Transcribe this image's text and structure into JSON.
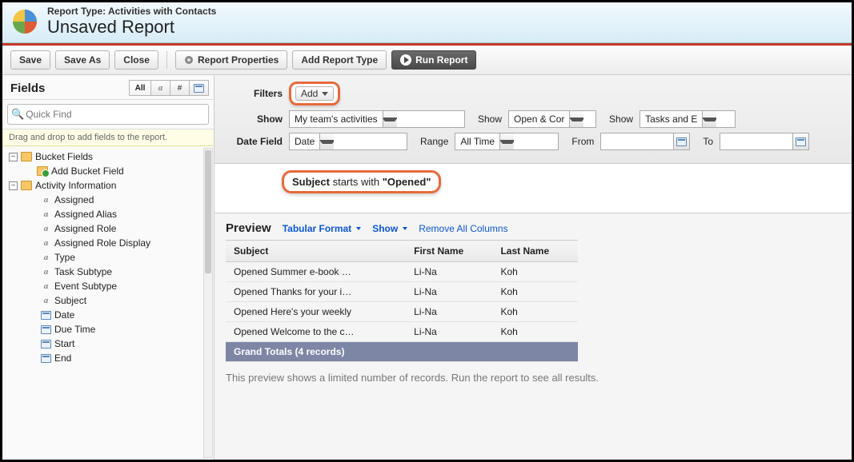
{
  "header": {
    "report_type_label": "Report Type: Activities with Contacts",
    "report_name": "Unsaved Report"
  },
  "toolbar": {
    "save": "Save",
    "save_as": "Save As",
    "close": "Close",
    "report_props": "Report Properties",
    "add_report_type": "Add Report Type",
    "run_report": "Run Report"
  },
  "sidebar": {
    "title": "Fields",
    "filter_all": "All",
    "quickfind_placeholder": "Quick Find",
    "drag_hint": "Drag and drop to add fields to the report.",
    "bucket_fields_label": "Bucket Fields",
    "add_bucket_label": "Add Bucket Field",
    "activity_info_label": "Activity Information",
    "fields": [
      {
        "label": "Assigned",
        "type": "text"
      },
      {
        "label": "Assigned Alias",
        "type": "text"
      },
      {
        "label": "Assigned Role",
        "type": "text"
      },
      {
        "label": "Assigned Role Display",
        "type": "text"
      },
      {
        "label": "Type",
        "type": "text"
      },
      {
        "label": "Task Subtype",
        "type": "text"
      },
      {
        "label": "Event Subtype",
        "type": "text"
      },
      {
        "label": "Subject",
        "type": "text"
      },
      {
        "label": "Date",
        "type": "date"
      },
      {
        "label": "Due Time",
        "type": "date"
      },
      {
        "label": "Start",
        "type": "date"
      },
      {
        "label": "End",
        "type": "date"
      }
    ]
  },
  "filters": {
    "filters_label": "Filters",
    "add_label": "Add",
    "show_label": "Show",
    "show_value": "My team's activities",
    "show2_value": "Open & Cor",
    "show3_value": "Tasks and E",
    "date_field_label": "Date Field",
    "date_field_value": "Date",
    "range_label": "Range",
    "range_value": "All Time",
    "from_label": "From",
    "to_label": "To",
    "criteria_field": "Subject",
    "criteria_op": " starts with ",
    "criteria_val": "\"Opened\""
  },
  "preview": {
    "title": "Preview",
    "tabular": "Tabular Format",
    "show": "Show",
    "remove_all": "Remove All Columns",
    "columns": {
      "c0": "Subject",
      "c1": "First Name",
      "c2": "Last Name"
    },
    "rows": [
      {
        "subject": "Opened Summer e-book …",
        "first": "Li-Na",
        "last": "Koh"
      },
      {
        "subject": "Opened Thanks for your i…",
        "first": "Li-Na",
        "last": "Koh"
      },
      {
        "subject": "Opened Here's your weekly",
        "first": "Li-Na",
        "last": "Koh"
      },
      {
        "subject": "Opened Welcome to the c…",
        "first": "Li-Na",
        "last": "Koh"
      }
    ],
    "grand_totals": "Grand Totals (4 records)",
    "note": "This preview shows a limited number of records. Run the report to see all results."
  }
}
